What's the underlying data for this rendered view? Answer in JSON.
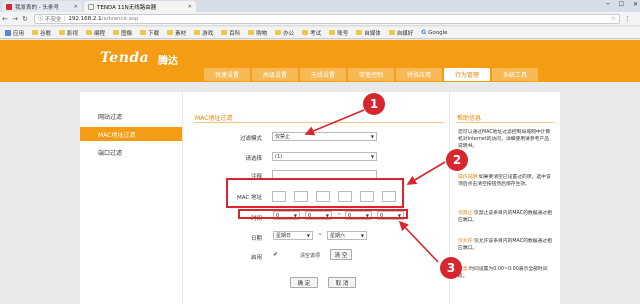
{
  "browser": {
    "tabs": [
      {
        "title": "我发表的 - 头条号",
        "favicon_color": "#d8262f",
        "active": false
      },
      {
        "title": "TENDA 11N无线路由器",
        "favicon_color": "#ffffff",
        "active": true
      }
    ],
    "address": {
      "security_label": "不安全",
      "host": "192.168.2.1",
      "path": "/advance.asp"
    },
    "bookmarks": [
      {
        "label": "应用",
        "icon": "apps-icon"
      },
      {
        "label": "谷歌",
        "icon": "folder-icon"
      },
      {
        "label": "影视",
        "icon": "folder-icon"
      },
      {
        "label": "编程",
        "icon": "folder-icon"
      },
      {
        "label": "图像",
        "icon": "folder-icon"
      },
      {
        "label": "下载",
        "icon": "folder-icon"
      },
      {
        "label": "素材",
        "icon": "folder-icon"
      },
      {
        "label": "游戏",
        "icon": "folder-icon"
      },
      {
        "label": "百科",
        "icon": "folder-icon"
      },
      {
        "label": "购物",
        "icon": "folder-icon"
      },
      {
        "label": "办公",
        "icon": "folder-icon"
      },
      {
        "label": "考试",
        "icon": "folder-icon"
      },
      {
        "label": "账号",
        "icon": "folder-icon"
      },
      {
        "label": "自媒体",
        "icon": "folder-icon"
      },
      {
        "label": "自媒好",
        "icon": "folder-icon"
      },
      {
        "label": "Google",
        "icon": "google-icon"
      }
    ]
  },
  "brand": {
    "logo": "Tenda",
    "logo_cn": "腾达",
    "header_color": "#f39c14",
    "accent": "#e68500"
  },
  "nav": {
    "tabs": [
      "快速设置",
      "高级设置",
      "无线设置",
      "带宽控制",
      "特殊应用",
      "行为管理",
      "系统工具"
    ],
    "active": "行为管理"
  },
  "sidebar": {
    "items": [
      "网站过滤",
      "MAC地址过滤",
      "端口过滤"
    ],
    "active": "MAC地址过滤"
  },
  "form": {
    "title": "MAC地址过滤",
    "mode_label": "过滤模式",
    "mode_value": "仅禁止",
    "select_label": "请选择",
    "select_value": "(1)",
    "note_label": "注释",
    "mac_label": "MAC 地址",
    "time_label": "时间",
    "time_values": [
      "0",
      "0",
      "0",
      "0"
    ],
    "time_sep": "~",
    "date_label": "日期",
    "date_from": "星期日",
    "date_sep": "~",
    "date_to": "星期六",
    "enable_label": "启用",
    "clear_label": "清空该项",
    "clear_button": "清 空",
    "ok_button": "确 定",
    "cancel_button": "取 消"
  },
  "help": {
    "title": "帮助信息",
    "para1": "您可以通过MAC地址过滤控制局域网中计算机对Internet的访问，详细使用请参考产品说明书。",
    "para2_hl": "操作说明:",
    "para2": "如果要清空已设置过的项，选中该项后点击清空按钮然后保存生效。",
    "para3_hl": "仅禁止:",
    "para3": "仅禁止该条目内的MAC的数据通过相应端口。",
    "para4_hl": "仅允许:",
    "para4": "仅允许该条目内的MAC的数据通过相应端口。",
    "para5_hl": "注意:",
    "para5": "时间设置为0:00~0:00表示全部时间段。"
  },
  "annotations": {
    "markers": [
      "1",
      "2",
      "3"
    ],
    "color": "#d8262f"
  }
}
